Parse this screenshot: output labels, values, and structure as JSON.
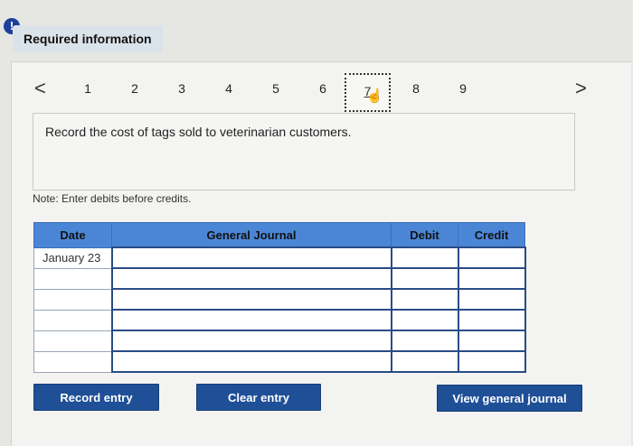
{
  "header": {
    "alert_icon": "!",
    "title": "Required information"
  },
  "nav": {
    "prev_icon": "<",
    "next_icon": ">",
    "pages": [
      "1",
      "2",
      "3",
      "4",
      "5",
      "6",
      "7",
      "8",
      "9"
    ],
    "current": "7",
    "current_cursor": "hand-pointer-icon"
  },
  "prompt": {
    "text": "Record the cost of tags sold to veterinarian customers."
  },
  "note": "Note: Enter debits before credits.",
  "journal": {
    "headers": {
      "date": "Date",
      "general_journal": "General Journal",
      "debit": "Debit",
      "credit": "Credit"
    },
    "rows": [
      {
        "date": "January 23",
        "account": "",
        "debit": "",
        "credit": ""
      },
      {
        "date": "",
        "account": "",
        "debit": "",
        "credit": ""
      },
      {
        "date": "",
        "account": "",
        "debit": "",
        "credit": ""
      },
      {
        "date": "",
        "account": "",
        "debit": "",
        "credit": ""
      },
      {
        "date": "",
        "account": "",
        "debit": "",
        "credit": ""
      },
      {
        "date": "",
        "account": "",
        "debit": "",
        "credit": ""
      }
    ]
  },
  "buttons": {
    "record": "Record entry",
    "clear": "Clear entry",
    "view": "View general journal"
  }
}
